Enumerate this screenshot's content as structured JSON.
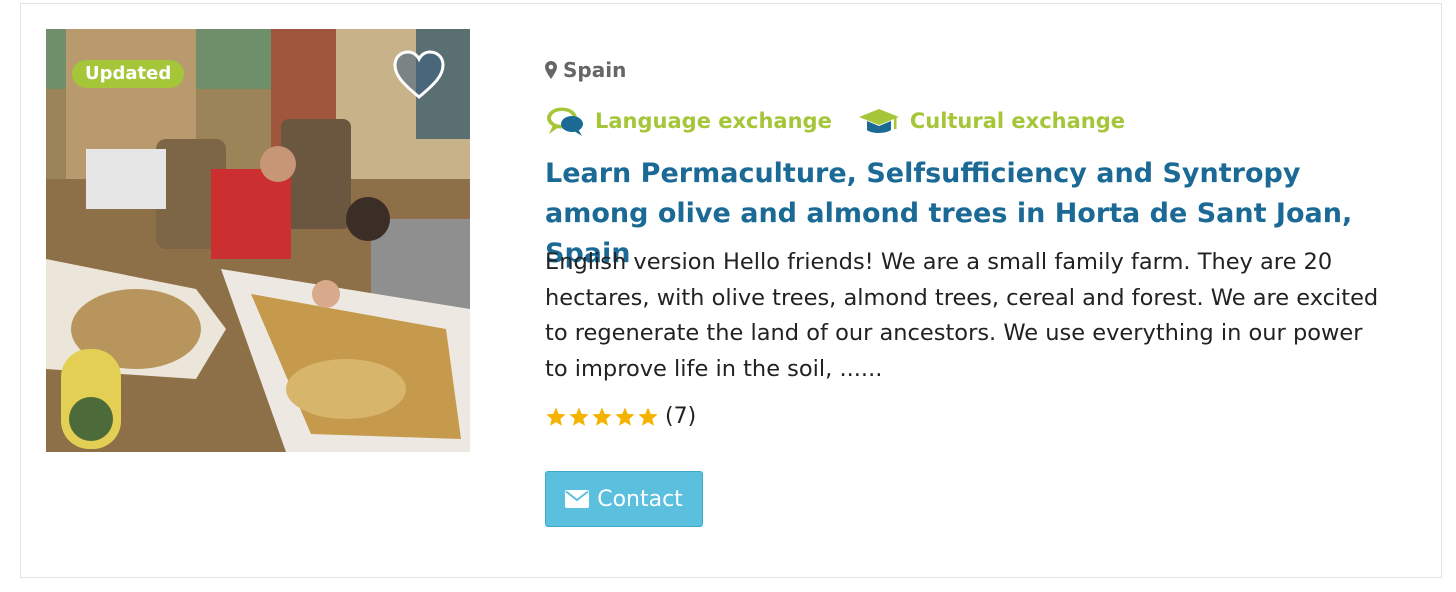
{
  "listing": {
    "badge": "Updated",
    "location": "Spain",
    "tags": [
      "Language exchange",
      "Cultural exchange"
    ],
    "title": "Learn Permaculture, Selfsufficiency and Syntropy among olive and almond trees in Horta de Sant Joan, Spain",
    "description": "English version Hello friends! We are a small family farm. They are 20 hectares, with olive trees, almond trees, cereal and forest. We are excited to regenerate the land of our ancestors. We use everything in our power to improve life in the soil, ......",
    "rating": {
      "stars": 5,
      "max": 5,
      "count_label": "(7)"
    },
    "contact_label": "Contact"
  },
  "icons": {
    "location": "map-marker-icon",
    "language": "speech-bubbles-icon",
    "cultural": "graduation-cap-icon",
    "favorite": "heart-icon",
    "contact": "envelope-icon",
    "star": "star-icon"
  },
  "colors": {
    "accent_green": "#a6c63a",
    "title_blue": "#1b6a96",
    "button_blue": "#5bc0de",
    "star_gold": "#f5b301",
    "muted_gray": "#666666"
  }
}
